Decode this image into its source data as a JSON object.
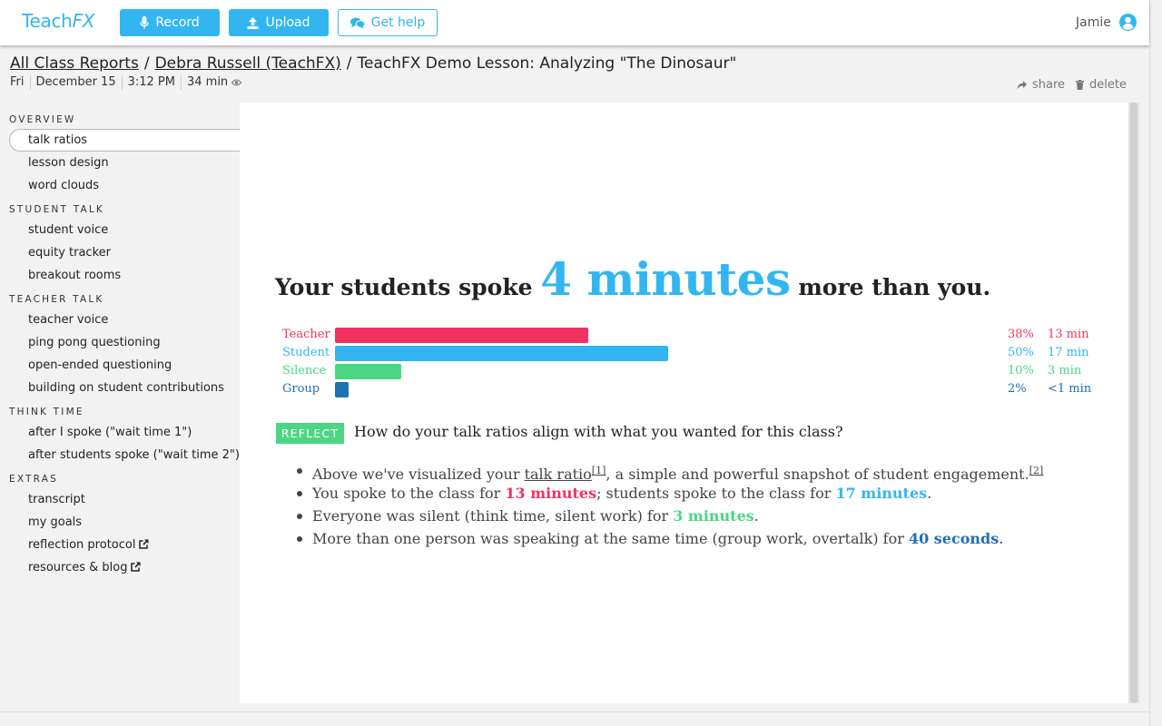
{
  "header": {
    "logo_main": "Teach",
    "logo_fx": "FX",
    "record_label": "Record",
    "upload_label": "Upload",
    "help_label": "Get help",
    "user_name": "Jamie"
  },
  "breadcrumb": {
    "crumb1": "All Class Reports",
    "crumb2": "Debra Russell (TeachFX)",
    "current": "TeachFX Demo Lesson: Analyzing \"The Dinosaur\"",
    "sep": "/"
  },
  "meta": {
    "day": "Fri",
    "date": "December 15",
    "time": "3:12 PM",
    "duration": "34 min"
  },
  "actions": {
    "share": "share",
    "delete": "delete"
  },
  "sidebar": {
    "overview": "OVERVIEW",
    "talk_ratios": "talk ratios",
    "lesson_design": "lesson design",
    "word_clouds": "word clouds",
    "student_talk": "STUDENT TALK",
    "student_voice": "student voice",
    "equity_tracker": "equity tracker",
    "breakout_rooms": "breakout rooms",
    "teacher_talk": "TEACHER TALK",
    "teacher_voice": "teacher voice",
    "ping_pong": "ping pong questioning",
    "open_ended": "open-ended questioning",
    "building": "building on student contributions",
    "think_time": "THINK TIME",
    "wait1": "after I spoke (\"wait time 1\")",
    "wait2": "after students spoke (\"wait time 2\")",
    "extras": "EXTRAS",
    "transcript": "transcript",
    "my_goals": "my goals",
    "reflection_protocol": "reflection protocol",
    "resources_blog": "resources & blog"
  },
  "headline": {
    "pre": "Your students spoke ",
    "num": "4",
    "unit": "minutes",
    "post": "more than you."
  },
  "chart_data": {
    "type": "bar",
    "categories": [
      "Teacher",
      "Student",
      "Silence",
      "Group"
    ],
    "values": [
      38,
      50,
      10,
      2
    ],
    "percent_labels": [
      "38%",
      "50%",
      "10%",
      "2%"
    ],
    "duration_labels": [
      "13 min",
      "17 min",
      "3 min",
      "<1 min"
    ],
    "colors": [
      "#f2325f",
      "#33b6ef",
      "#4cd684",
      "#1f6fb5"
    ],
    "xlim": [
      0,
      100
    ]
  },
  "reflect": {
    "badge": "REFLECT",
    "question": "How do your talk ratios align with what you wanted for this class?"
  },
  "bullets": {
    "b1_pre": "Above we've visualized your ",
    "b1_link": "talk ratio",
    "b1_ref1": "[1]",
    "b1_mid": ", a simple and powerful snapshot of student engagement.",
    "b1_ref2": "[2]",
    "b2_pre": "You spoke to the class for ",
    "b2_t": "13 minutes",
    "b2_mid": "; students spoke to the class for ",
    "b2_s": "17 minutes",
    "b2_end": ".",
    "b3_pre": "Everyone was silent (think time, silent work) for ",
    "b3_v": "3 minutes",
    "b3_end": ".",
    "b4_pre": "More than one person was speaking at the same time (group work, overtalk) for ",
    "b4_v": "40 seconds",
    "b4_end": "."
  }
}
